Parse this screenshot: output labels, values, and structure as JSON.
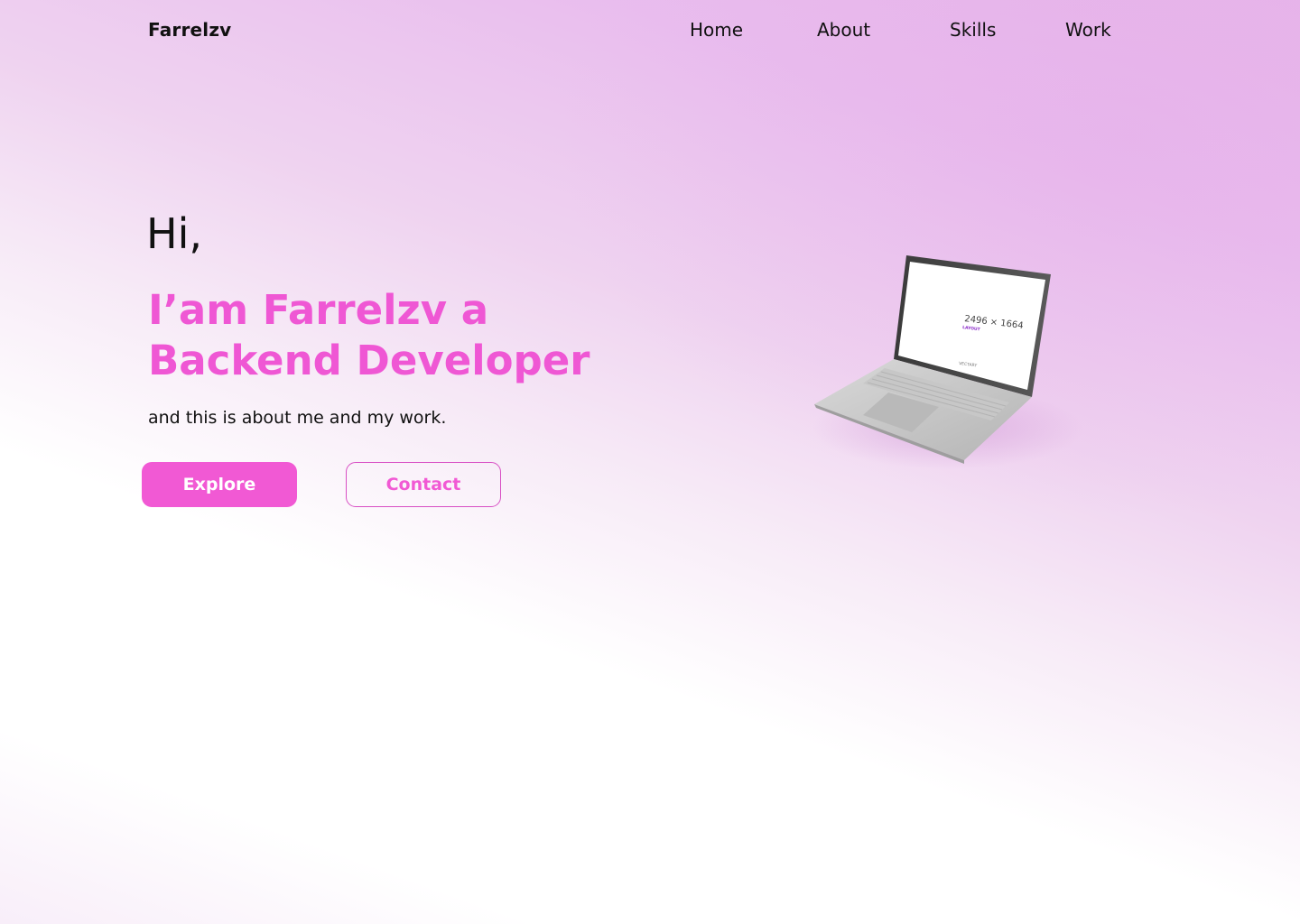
{
  "header": {
    "brand": "Farrelzv",
    "nav": [
      {
        "label": "Home"
      },
      {
        "label": "About"
      },
      {
        "label": "Skills"
      },
      {
        "label": "Work"
      }
    ]
  },
  "hero": {
    "greeting": "Hi,",
    "headline_line1": "I’am Farrelzv a",
    "headline_line2": "Backend Developer",
    "subtitle": "and this is about me and my work.",
    "explore_label": "Explore",
    "contact_label": "Contact"
  },
  "laptop_screen": {
    "resolution": "2496 × 1664",
    "layout_label": "LAYOUT",
    "brand_label": "VECTARY"
  },
  "colors": {
    "accent": "#f159d4",
    "text": "#111111",
    "background_top": "#e7b6ea",
    "background_bottom": "#ffffff"
  },
  "icons": {
    "laptop": "laptop-illustration"
  }
}
